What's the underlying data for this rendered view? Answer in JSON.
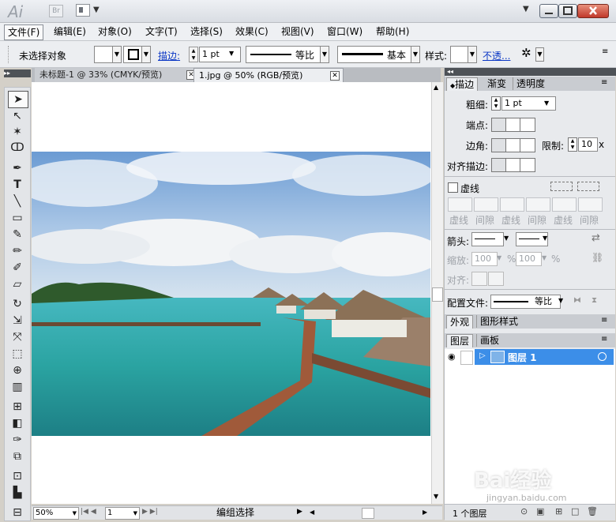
{
  "app": {
    "logo": "Ai",
    "bridge_logo": "Br"
  },
  "menu": [
    "文件(F)",
    "编辑(E)",
    "对象(O)",
    "文字(T)",
    "选择(S)",
    "效果(C)",
    "视图(V)",
    "窗口(W)",
    "帮助(H)"
  ],
  "control": {
    "selection_status": "未选择对象",
    "stroke_label": "描边:",
    "stroke_weight": "1 pt",
    "profile": "等比",
    "brush": "基本",
    "style_label": "样式:",
    "opacity_label": "不透..."
  },
  "tabs": [
    {
      "label": "未标题-1 @ 33% (CMYK/预览)"
    },
    {
      "label": "1.jpg @ 50% (RGB/预览)"
    }
  ],
  "status": {
    "zoom": "50%",
    "page": "1",
    "mode": "编组选择"
  },
  "stroke_panel": {
    "tabs": [
      "描边",
      "渐变",
      "透明度"
    ],
    "weight_label": "粗细:",
    "weight_value": "1 pt",
    "cap_label": "端点:",
    "corner_label": "边角:",
    "limit_label": "限制:",
    "limit_value": "10",
    "limit_suffix": "x",
    "align_label": "对齐描边:",
    "dashed_label": "虚线",
    "dash_labels": [
      "虚线",
      "间隙",
      "虚线",
      "间隙",
      "虚线",
      "间隙"
    ],
    "arrow_label": "箭头:",
    "scale_label": "缩放:",
    "scale_value1": "100",
    "scale_value2": "100",
    "percent": "%",
    "align2_label": "对齐:",
    "profile_label": "配置文件:",
    "profile_value": "等比"
  },
  "appearance_panel": {
    "tabs": [
      "外观",
      "图形样式"
    ]
  },
  "layers_panel": {
    "tabs": [
      "图层",
      "画板"
    ],
    "layer_name": "图层 1",
    "footer": "1 个图层"
  },
  "watermark": {
    "text": "Bai经验",
    "url": "jingyan.baidu.com"
  },
  "colors": {
    "layer_highlight": "#3c8ee8",
    "accent_link": "#0b37c5"
  }
}
